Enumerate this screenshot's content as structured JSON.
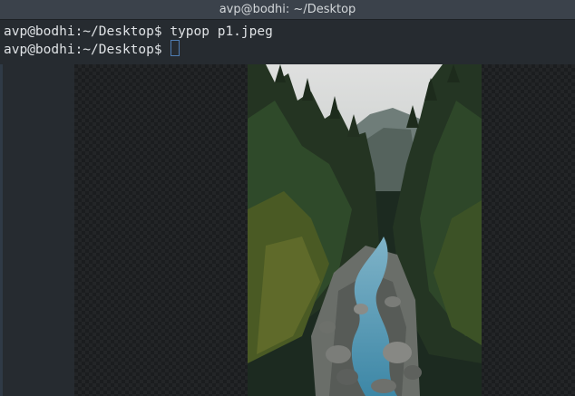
{
  "window": {
    "title": "avp@bodhi: ~/Desktop"
  },
  "terminal": {
    "lines": [
      {
        "prompt": "avp@bodhi:~/Desktop$",
        "command": "typop p1.jpeg"
      },
      {
        "prompt": "avp@bodhi:~/Desktop$",
        "command": ""
      }
    ]
  },
  "image_viewer": {
    "file": "p1.jpeg",
    "content": "forest-river-photo"
  },
  "colors": {
    "titlebar": "#3b424b",
    "terminal_bg": "#262b30",
    "text": "#dfe2e5",
    "cursor": "#4f7db3"
  }
}
